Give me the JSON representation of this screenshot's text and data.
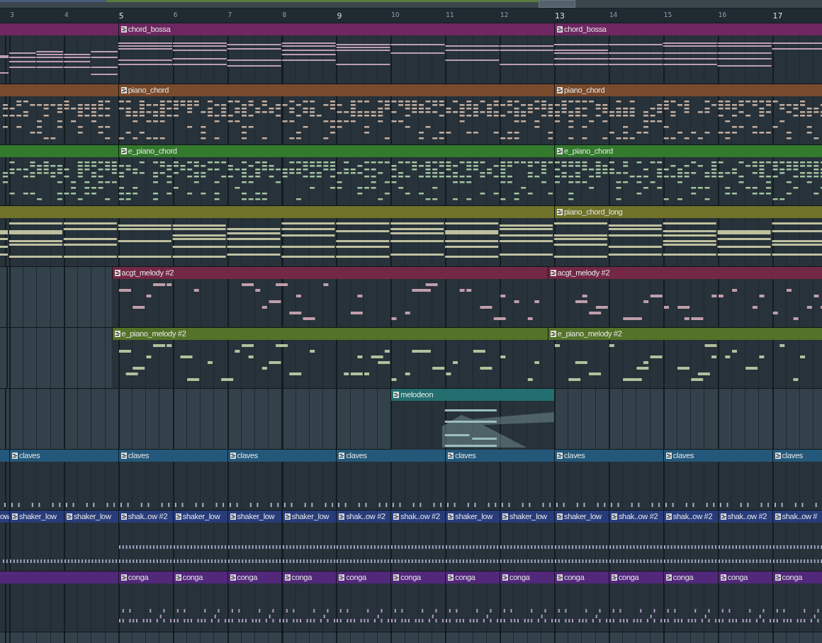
{
  "ruler": [
    {
      "label": "3",
      "emphasized": false
    },
    {
      "label": "4",
      "emphasized": false
    },
    {
      "label": "5",
      "emphasized": true
    },
    {
      "label": "6",
      "emphasized": false
    },
    {
      "label": "7",
      "emphasized": false
    },
    {
      "label": "8",
      "emphasized": false
    },
    {
      "label": "9",
      "emphasized": true
    },
    {
      "label": "10",
      "emphasized": false
    },
    {
      "label": "11",
      "emphasized": false
    },
    {
      "label": "12",
      "emphasized": false
    },
    {
      "label": "13",
      "emphasized": true
    },
    {
      "label": "14",
      "emphasized": false
    },
    {
      "label": "15",
      "emphasized": false
    },
    {
      "label": "16",
      "emphasized": false
    },
    {
      "label": "17",
      "emphasized": true
    }
  ],
  "tracks": [
    {
      "kind": "chord",
      "color": "#6e2760",
      "clips": [
        {
          "label": "chord_bossa"
        },
        {
          "label": "chord_bossa"
        }
      ]
    },
    {
      "kind": "stab",
      "color": "#7a4a2c",
      "clips": [
        {
          "label": "piano_chord"
        },
        {
          "label": "piano_chord"
        }
      ]
    },
    {
      "kind": "stab",
      "color": "#337a2c",
      "clips": [
        {
          "label": "e_piano_chord"
        },
        {
          "label": "e_piano_chord"
        }
      ]
    },
    {
      "kind": "sustain",
      "color": "#6f7228",
      "clips": [
        {
          "label": "piano_chord_long"
        }
      ]
    },
    {
      "kind": "melody",
      "color": "#732843",
      "clips": [
        {
          "label": "acgt_melody #2"
        },
        {
          "label": "acgt_melody #2"
        }
      ]
    },
    {
      "kind": "melody",
      "color": "#557328",
      "clips": [
        {
          "label": "e_piano_melody #2"
        },
        {
          "label": "e_piano_melody #2"
        }
      ]
    },
    {
      "kind": "melodeon",
      "color": "#236e6e",
      "clips": [
        {
          "label": "melodeon"
        }
      ]
    },
    {
      "kind": "hits",
      "color": "#24587a",
      "clips": [
        {
          "label": "claves"
        },
        {
          "label": "claves"
        },
        {
          "label": "claves"
        },
        {
          "label": "claves"
        },
        {
          "label": "claves"
        },
        {
          "label": "claves"
        },
        {
          "label": "claves"
        },
        {
          "label": "claves"
        }
      ]
    },
    {
      "kind": "roll",
      "color": "#283c7a",
      "clips": [
        {
          "label": "ow"
        },
        {
          "label": "shaker_low"
        },
        {
          "label": "shaker_low"
        },
        {
          "label": "shak..ow #2"
        },
        {
          "label": "shaker_low"
        },
        {
          "label": "shaker_low"
        },
        {
          "label": "shaker_low"
        },
        {
          "label": "shak..ow #2"
        },
        {
          "label": "shak..ow #2"
        },
        {
          "label": "shaker_low"
        },
        {
          "label": "shaker_low"
        },
        {
          "label": "shaker_low"
        },
        {
          "label": "shak..ow #2"
        },
        {
          "label": "shak..ow #2"
        },
        {
          "label": "shak..ow #2"
        },
        {
          "label": "shak..ow #"
        }
      ]
    },
    {
      "kind": "perc",
      "color": "#52287a",
      "clips": [
        {
          "label": "conga"
        },
        {
          "label": "conga"
        },
        {
          "label": "conga"
        },
        {
          "label": "conga"
        },
        {
          "label": "conga"
        },
        {
          "label": "conga"
        },
        {
          "label": "conga"
        },
        {
          "label": "conga"
        },
        {
          "label": "conga"
        },
        {
          "label": "conga"
        },
        {
          "label": "conga"
        },
        {
          "label": "conga"
        },
        {
          "label": "conga"
        }
      ]
    }
  ]
}
